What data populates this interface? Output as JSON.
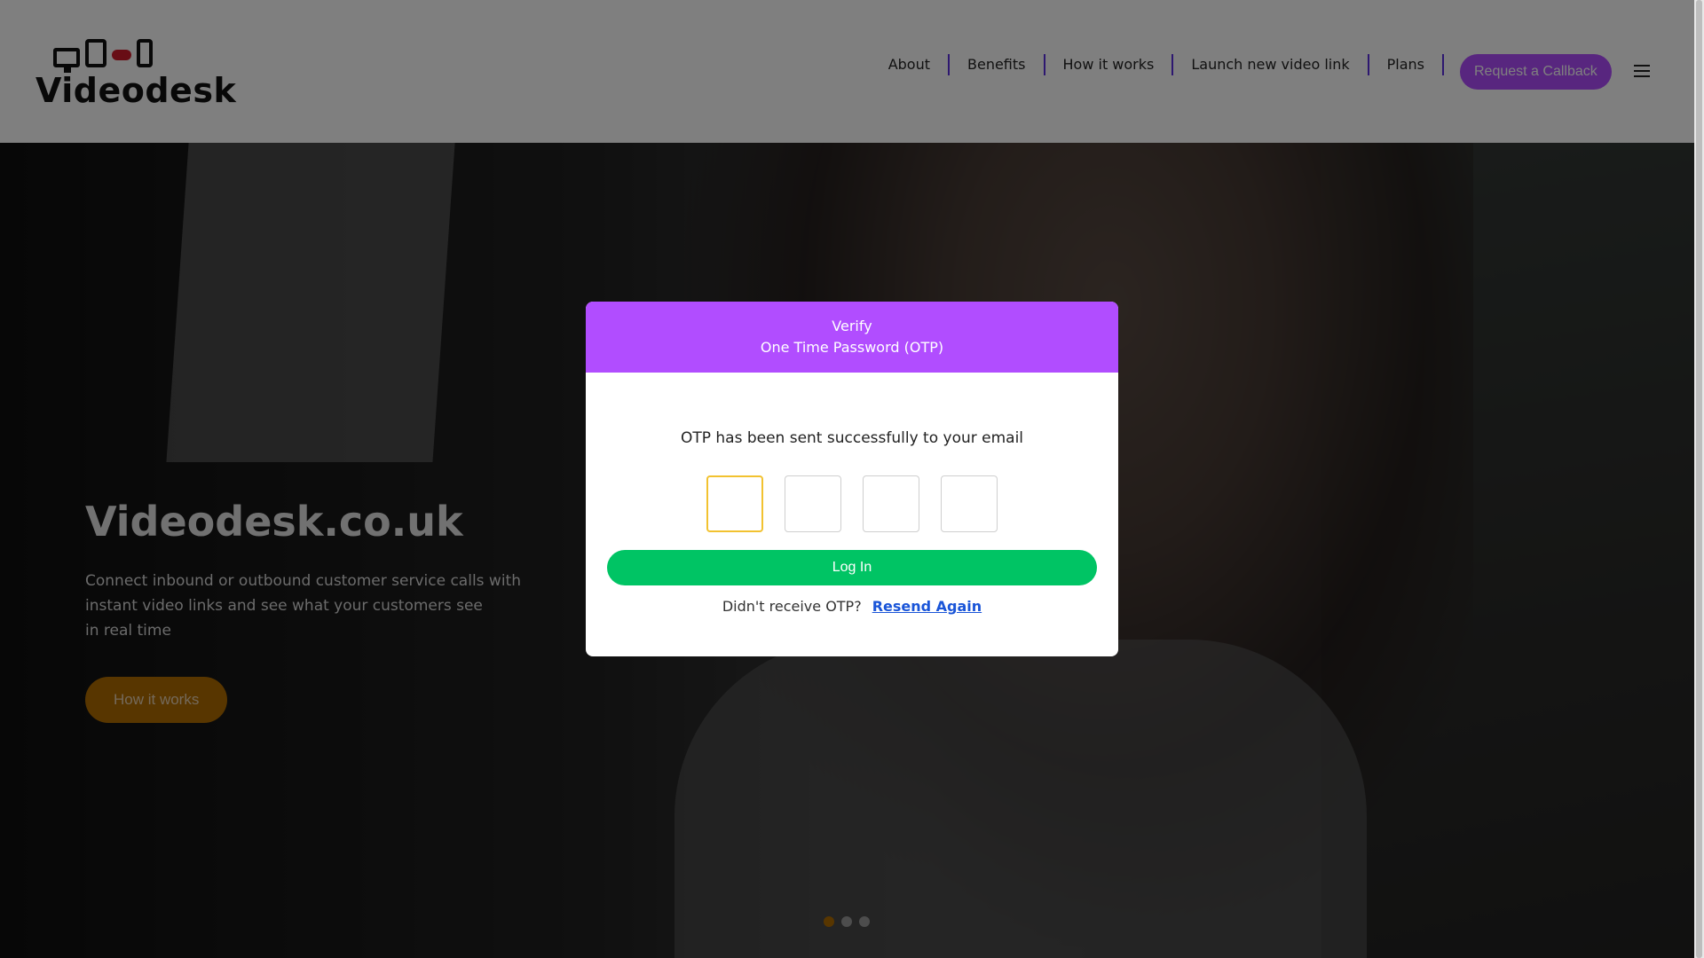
{
  "header": {
    "logo_text": "Videodesk",
    "nav": [
      "About",
      "Benefits",
      "How it works",
      "Launch new video link",
      "Plans"
    ],
    "callback_label": "Request a Callback"
  },
  "hero": {
    "title": "Videodesk.co.uk",
    "description_lines": [
      "Connect inbound or outbound customer service calls with",
      "instant video links and see what your customers see",
      "in real time"
    ],
    "button_label": "How it works",
    "slide_count": 3,
    "active_slide": 1
  },
  "modal": {
    "title_line1": "Verify",
    "title_line2": "One Time Password (OTP)",
    "message": "OTP has been sent successfully to your email",
    "otp_values": [
      "",
      "",
      "",
      ""
    ],
    "login_label": "Log In",
    "resend_prompt": "Didn't receive OTP?",
    "resend_link": "Resend Again"
  },
  "colors": {
    "accent": "#b14dff",
    "success": "#00c464",
    "hero_button": "#b16c00",
    "nav_divider": "#5b2ee0",
    "focus_border": "#f2c230",
    "link": "#1a55d8"
  }
}
